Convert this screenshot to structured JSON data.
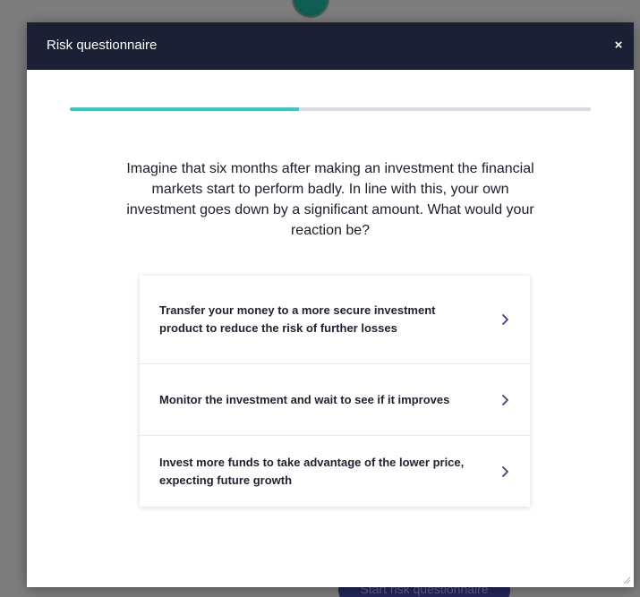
{
  "modal": {
    "title": "Risk questionnaire",
    "close_glyph": "×",
    "progress_fraction": 0.44,
    "question": "Imagine that six months after making an investment the financial markets start to perform badly. In line with this, your own investment goes down by a significant amount. What would your reaction be?",
    "options": [
      {
        "label": "Transfer your money to a more secure investment product to reduce the risk of further losses",
        "icon": "chevron-right-icon"
      },
      {
        "label": "Monitor the investment and wait to see if it improves",
        "icon": "chevron-right-icon"
      },
      {
        "label": "Invest more funds to take advantage of the lower price, expecting future growth",
        "icon": "chevron-right-icon"
      }
    ]
  },
  "background": {
    "start_button_label": "Start risk questionnaire"
  },
  "colors": {
    "header_bg": "#1c2034",
    "progress_fill": "#34c9c5",
    "progress_track": "#dadbe3",
    "chevron": "#3b3f8f"
  }
}
